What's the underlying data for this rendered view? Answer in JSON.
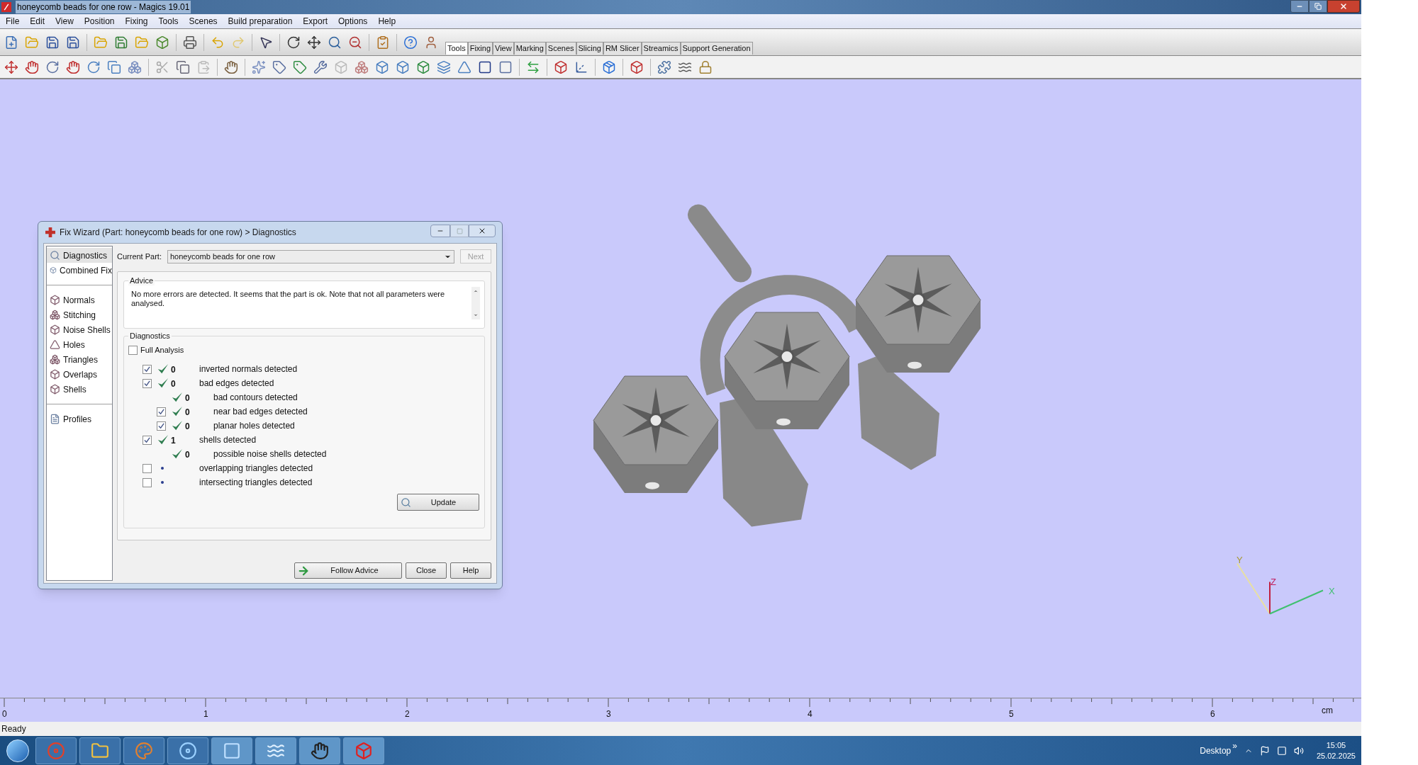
{
  "window": {
    "title": "honeycomb beads for one row - Magics 19.01"
  },
  "menu": [
    "File",
    "Edit",
    "View",
    "Position",
    "Fixing",
    "Tools",
    "Scenes",
    "Build preparation",
    "Export",
    "Options",
    "Help"
  ],
  "toolbar_tabs": [
    {
      "label": "Tools",
      "selected": true
    },
    {
      "label": "Fixing",
      "selected": false
    },
    {
      "label": "View",
      "selected": false
    },
    {
      "label": "Marking",
      "selected": false
    },
    {
      "label": "Scenes",
      "selected": false
    },
    {
      "label": "Slicing",
      "selected": false
    },
    {
      "label": "RM Slicer",
      "selected": false
    },
    {
      "label": "Streamics",
      "selected": false
    },
    {
      "label": "Support Generation",
      "selected": false
    }
  ],
  "axis_labels": {
    "y": "Y",
    "z": "Z",
    "x": "X"
  },
  "dialog": {
    "title": "Fix Wizard (Part: honeycomb beads for one row) > Diagnostics",
    "sidebar_groups": [
      [
        {
          "label": "Diagnostics",
          "selected": true
        },
        {
          "label": "Combined Fix",
          "selected": false
        }
      ],
      [
        {
          "label": "Normals",
          "selected": false
        },
        {
          "label": "Stitching",
          "selected": false
        },
        {
          "label": "Noise Shells",
          "selected": false
        },
        {
          "label": "Holes",
          "selected": false
        },
        {
          "label": "Triangles",
          "selected": false
        },
        {
          "label": "Overlaps",
          "selected": false
        },
        {
          "label": "Shells",
          "selected": false
        }
      ],
      [
        {
          "label": "Profiles",
          "selected": false
        }
      ]
    ],
    "current_part": {
      "label": "Current Part:",
      "value": "honeycomb beads for one row"
    },
    "next_button": {
      "label": "Next",
      "disabled": true
    },
    "advice": {
      "title": "Advice",
      "text": "No more errors are detected. It seems that the part is ok. Note that not all parameters were analysed."
    },
    "diagnostics": {
      "title": "Diagnostics",
      "full_analysis": {
        "label": "Full Analysis",
        "checked": false
      },
      "rows": [
        {
          "kind": "checkbox",
          "checked": true,
          "passed": true,
          "count": "0",
          "label": "inverted normals detected"
        },
        {
          "kind": "checkbox",
          "checked": true,
          "passed": true,
          "count": "0",
          "label": "bad edges detected",
          "children": [
            {
              "kind": "plain",
              "passed": true,
              "count": "0",
              "label": "bad contours detected"
            },
            {
              "kind": "checkbox",
              "checked": true,
              "passed": true,
              "count": "0",
              "label": "near bad edges detected"
            },
            {
              "kind": "checkbox",
              "checked": true,
              "passed": true,
              "count": "0",
              "label": "planar holes detected"
            }
          ]
        },
        {
          "kind": "checkbox",
          "checked": true,
          "passed": true,
          "count": "1",
          "label": "shells detected",
          "children": [
            {
              "kind": "plain",
              "passed": true,
              "count": "0",
              "label": "possible noise shells detected"
            }
          ]
        },
        {
          "kind": "checkbox",
          "checked": false,
          "passed": false,
          "label": "overlapping triangles detected"
        },
        {
          "kind": "checkbox",
          "checked": false,
          "passed": false,
          "label": "intersecting triangles detected"
        }
      ],
      "update_button": "Update"
    },
    "buttons": [
      "Follow Advice",
      "Close",
      "Help"
    ]
  },
  "ruler": {
    "labels": [
      "0",
      "1",
      "2",
      "3",
      "4",
      "5",
      "6"
    ],
    "unit": "cm"
  },
  "status_bar": "Ready",
  "taskbar": {
    "desktop_label": "Desktop",
    "chevron": "»",
    "time": "15:05",
    "date": "25.02.2025"
  }
}
